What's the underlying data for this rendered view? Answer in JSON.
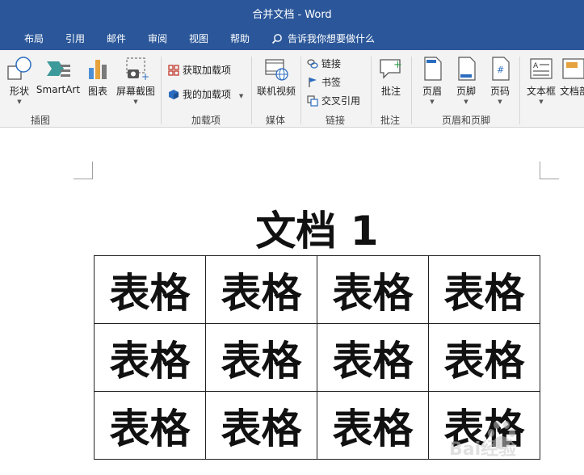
{
  "window": {
    "title": "合并文档  -  Word"
  },
  "menu": {
    "tabs": [
      "布局",
      "引用",
      "邮件",
      "审阅",
      "视图",
      "帮助"
    ],
    "tell_me": "告诉我你想要做什么"
  },
  "ribbon": {
    "illustrations": {
      "shapes": "形状",
      "smartart": "SmartArt",
      "chart": "图表",
      "screenshot": "屏幕截图",
      "group": "插图"
    },
    "addins": {
      "get": "获取加载项",
      "my": "我的加载项",
      "group": "加载项"
    },
    "media": {
      "online_video": "联机视频",
      "group": "媒体"
    },
    "links": {
      "link": "链接",
      "bookmark": "书签",
      "cross_ref": "交叉引用",
      "group": "链接"
    },
    "comments": {
      "comment": "批注",
      "group": "批注"
    },
    "header_footer": {
      "header": "页眉",
      "footer": "页脚",
      "page_number": "页码",
      "group": "页眉和页脚"
    },
    "text": {
      "textbox": "文本框",
      "quickparts": "文档部"
    }
  },
  "document": {
    "title": "文档 1",
    "table": [
      [
        "表格",
        "表格",
        "表格",
        "表格"
      ],
      [
        "表格",
        "表格",
        "表格",
        "表格"
      ],
      [
        "表格",
        "表格",
        "表格",
        "表格"
      ]
    ]
  },
  "watermark": {
    "text": "Bai经验"
  },
  "colors": {
    "ribbon_accent": "#2b579a",
    "ribbon_bg": "#f3f3f3"
  }
}
